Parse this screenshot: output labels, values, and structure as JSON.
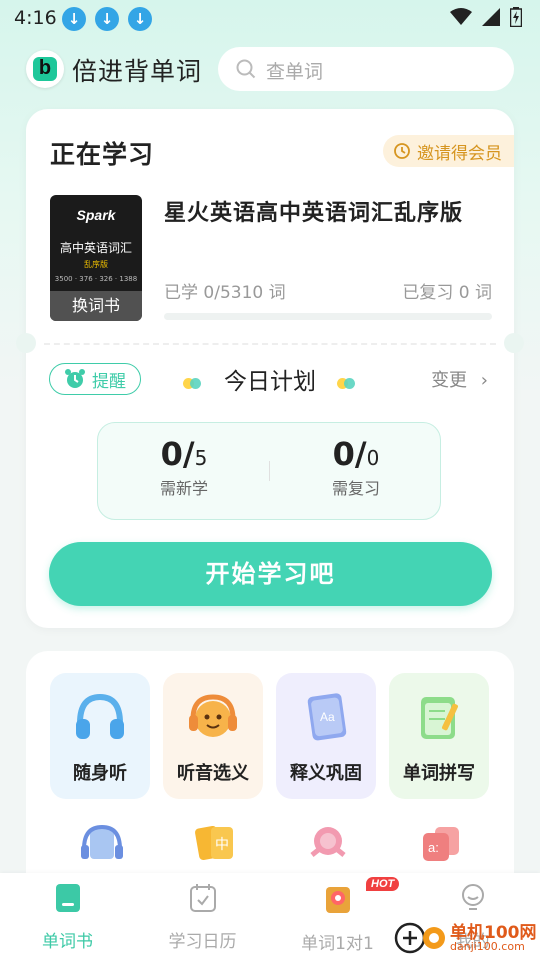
{
  "status_bar": {
    "time": "4:16"
  },
  "header": {
    "app_title": "倍进背单词",
    "search_placeholder": "查单词"
  },
  "study_card": {
    "section_title": "正在学习",
    "invite_badge": "邀请得会员",
    "book": {
      "cover_brand": "Spark",
      "cover_title": "高中英语词汇",
      "cover_subtitle": "乱序版",
      "cover_numbers": "3500 · 376 · 326 · 1388",
      "change_book_label": "换词书",
      "title": "星火英语高中英语词汇乱序版",
      "learned_text": "已学 0/5310 词",
      "reviewed_text": "已复习 0 词",
      "progress": 0
    },
    "remind_label": "提醒",
    "plan_title": "今日计划",
    "change_label": "变更",
    "stats": {
      "new_value": "0/",
      "new_target": "5",
      "new_label": "需新学",
      "review_value": "0/",
      "review_target": "0",
      "review_label": "需复习"
    },
    "start_button": "开始学习吧"
  },
  "features": {
    "tiles": [
      {
        "label": "随身听",
        "icon": "headphones-icon",
        "bg": "#eaf5fd"
      },
      {
        "label": "听音选义",
        "icon": "smiley-headphones-icon",
        "bg": "#fdf4ea"
      },
      {
        "label": "释义巩固",
        "icon": "book-aa-icon",
        "bg": "#efeefd"
      },
      {
        "label": "单词拼写",
        "icon": "notepad-pencil-icon",
        "bg": "#ecf9ea"
      }
    ],
    "second_row_icons": [
      "headset-card-icon",
      "chinese-card-icon",
      "astronaut-icon",
      "phonetic-card-icon"
    ]
  },
  "bottom_nav": {
    "items": [
      {
        "label": "单词书",
        "icon": "book-icon",
        "active": true
      },
      {
        "label": "学习日历",
        "icon": "calendar-icon",
        "active": false
      },
      {
        "label": "单词1对1",
        "icon": "tutor-icon",
        "active": false
      },
      {
        "label": "我的",
        "icon": "profile-icon",
        "active": false
      }
    ],
    "hot_badge": "HOT"
  },
  "watermark": {
    "line1": "单机100网",
    "line2": "danji100.com"
  },
  "colors": {
    "accent": "#44d4b4",
    "invite": "#d69520",
    "hot": "#f04040"
  }
}
